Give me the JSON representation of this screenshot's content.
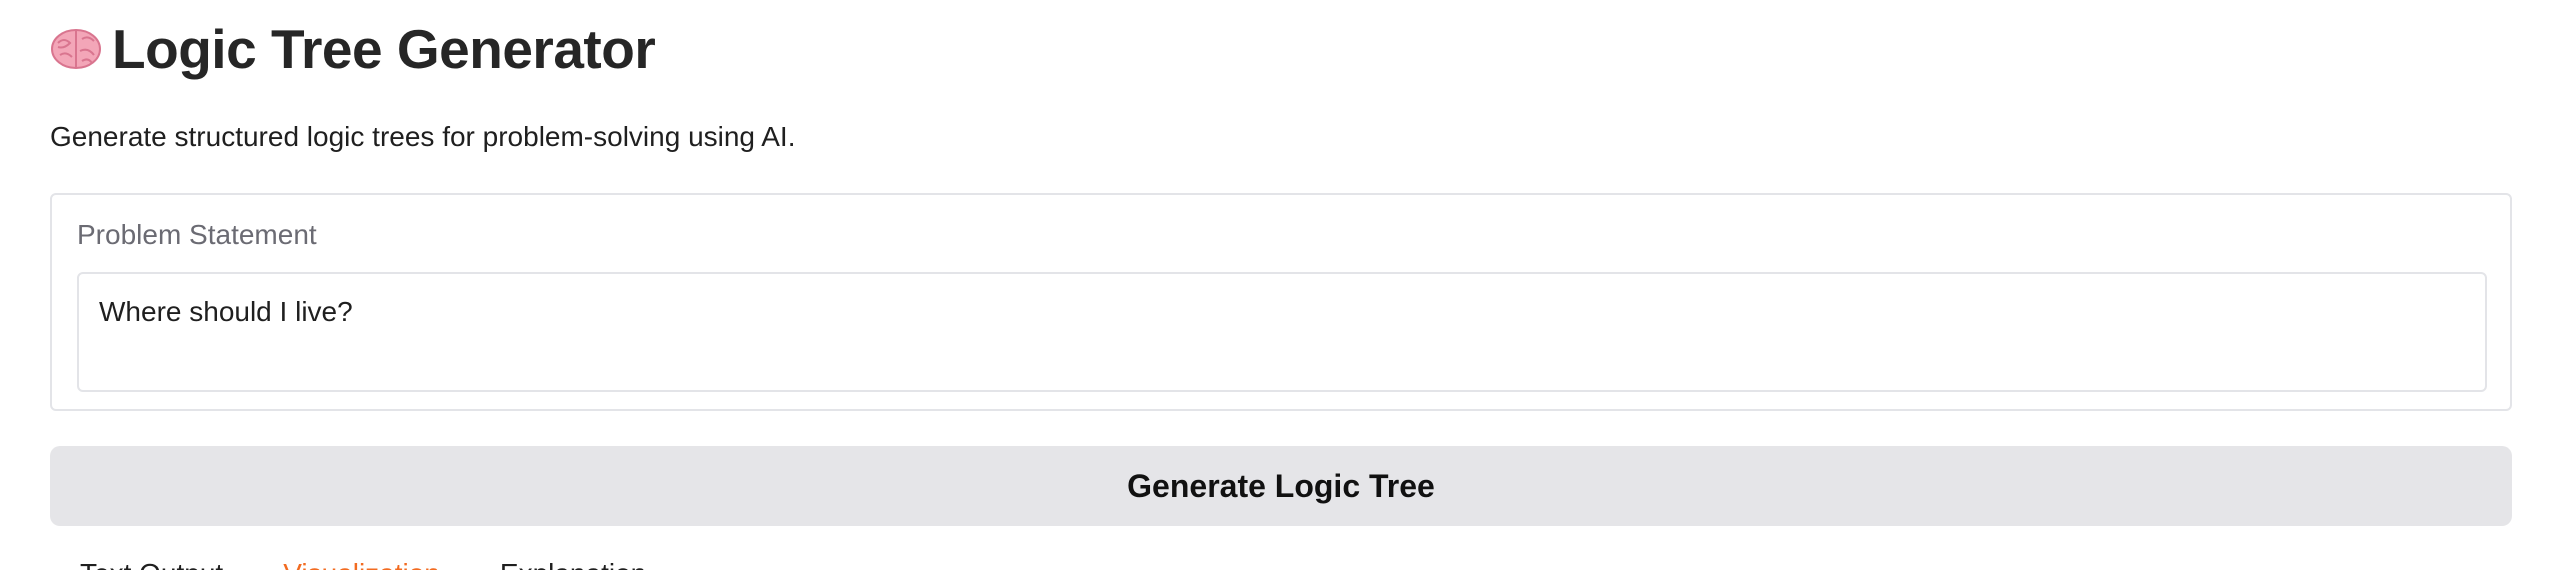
{
  "header": {
    "title": "Logic Tree Generator",
    "icon": "brain-icon"
  },
  "subtitle": "Generate structured logic trees for problem-solving using AI.",
  "problem": {
    "label": "Problem Statement",
    "value": "Where should I live?"
  },
  "generate_button": {
    "label": "Generate Logic Tree"
  },
  "tabs": [
    {
      "label": "Text Output",
      "active": false
    },
    {
      "label": "Visualization",
      "active": true
    },
    {
      "label": "Explanation",
      "active": false
    }
  ],
  "colors": {
    "accent": "#f26b21",
    "button_bg": "#e5e5e8",
    "border": "#e3e4e8"
  }
}
